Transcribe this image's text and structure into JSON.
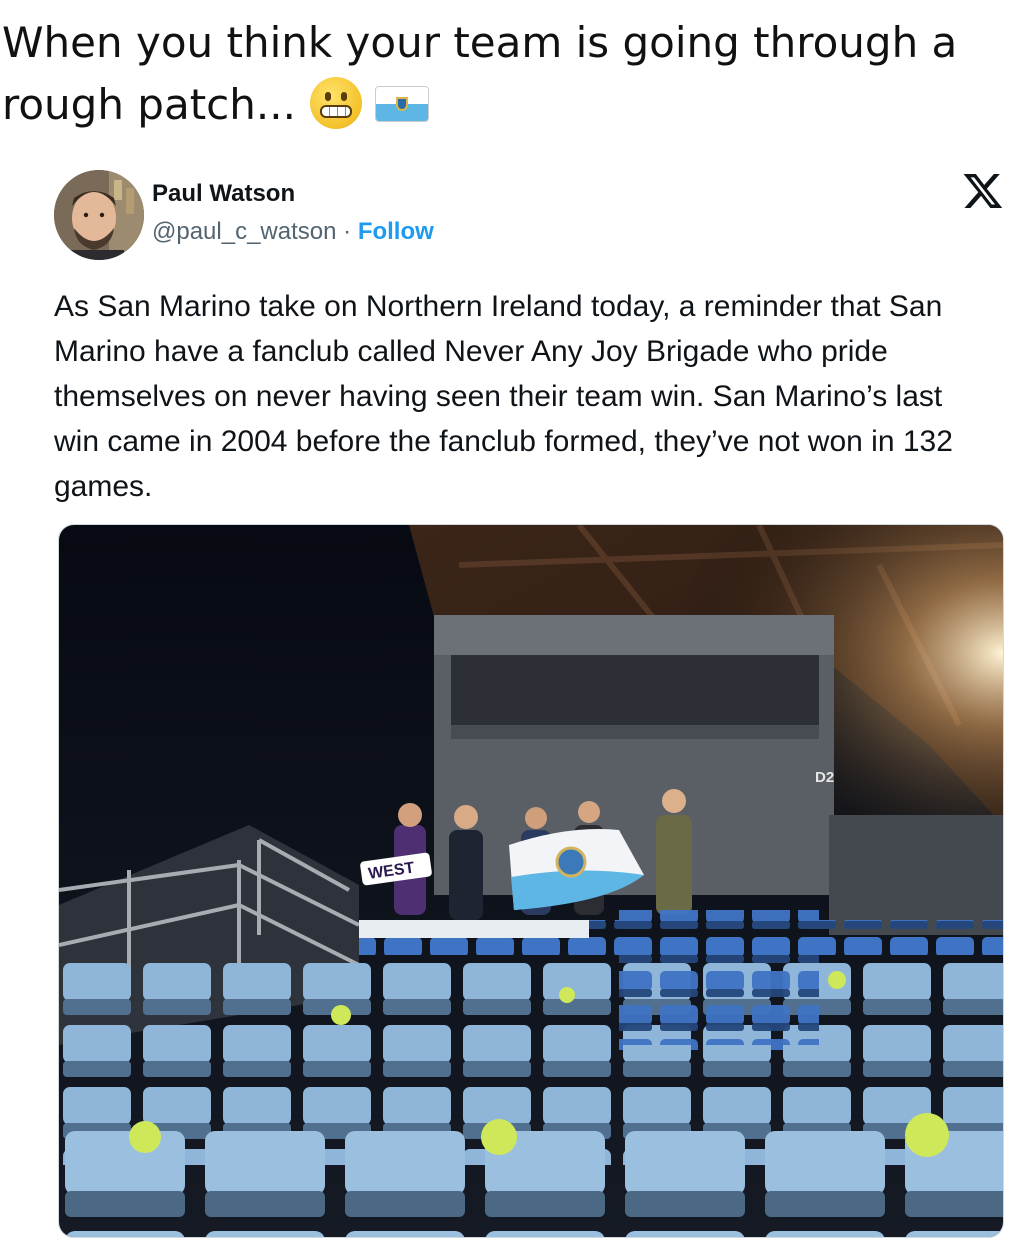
{
  "caption": {
    "text": "When you think your team is going through a rough patch...",
    "emojis": [
      "grimacing-face",
      "san-marino-flag"
    ]
  },
  "tweet": {
    "author_name": "Paul Watson",
    "handle": "@paul_c_watson",
    "separator": " · ",
    "follow_label": "Follow",
    "platform_icon": "x-logo-icon",
    "text": "As San Marino take on Northern Ireland today, a reminder that San Marino have a fanclub called Never Any Joy Brigade who pride themselves on never having seen their team win. San Marino’s last win came in 2004 before the fanclub formed, they’ve not won in 132 games.",
    "photo": {
      "banner_text": "WEST",
      "section_sign": "D2"
    }
  },
  "colors": {
    "link": "#1d9bf0",
    "secondary_text": "#536471",
    "seat_light_blue": "#8fb6d8",
    "seat_royal_blue": "#2f63b8",
    "sticker_green": "#cfe85a",
    "flag_blue": "#5eb6e4"
  }
}
